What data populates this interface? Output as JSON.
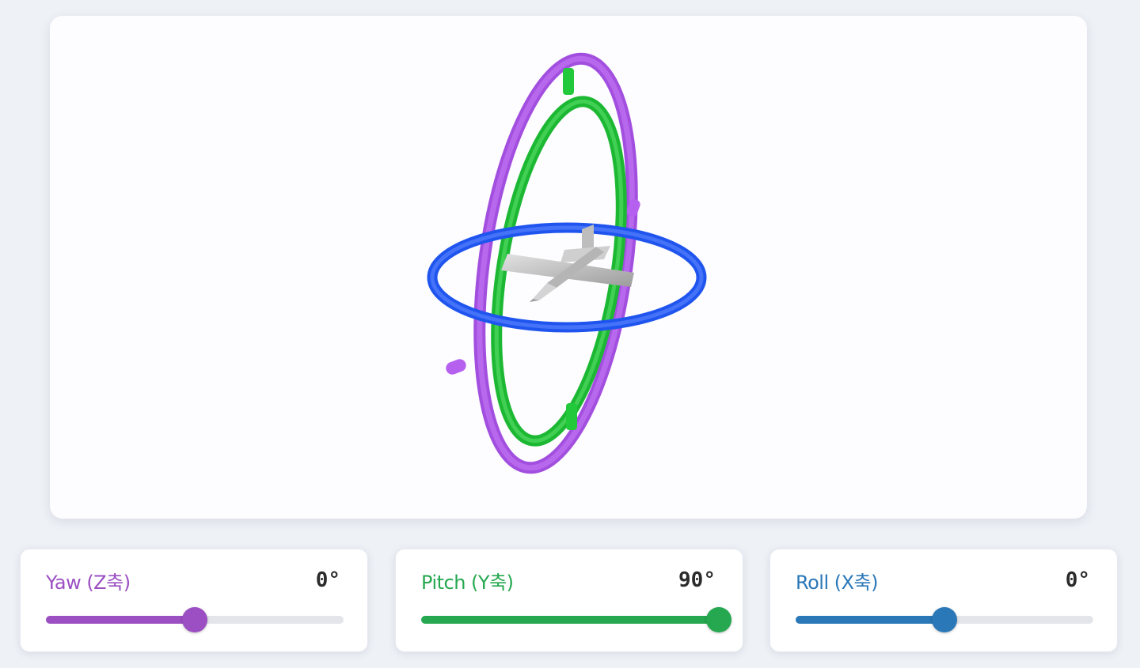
{
  "viewport": {
    "object_name": "airplane"
  },
  "controls": [
    {
      "id": "yaw",
      "label": "Yaw (Z축)",
      "value_text": "0°",
      "value_fraction": 0.5,
      "color": "#9b4fc2"
    },
    {
      "id": "pitch",
      "label": "Pitch (Y축)",
      "value_text": "90°",
      "value_fraction": 1.0,
      "color": "#25a84f"
    },
    {
      "id": "roll",
      "label": "Roll (X축)",
      "value_text": "0°",
      "value_fraction": 0.5,
      "color": "#2a78b8"
    }
  ],
  "colors": {
    "yaw_ring": "#b660f0",
    "pitch_ring": "#22c93a",
    "roll_ring": "#2a5ef5",
    "aircraft": "#c8c8c8"
  }
}
